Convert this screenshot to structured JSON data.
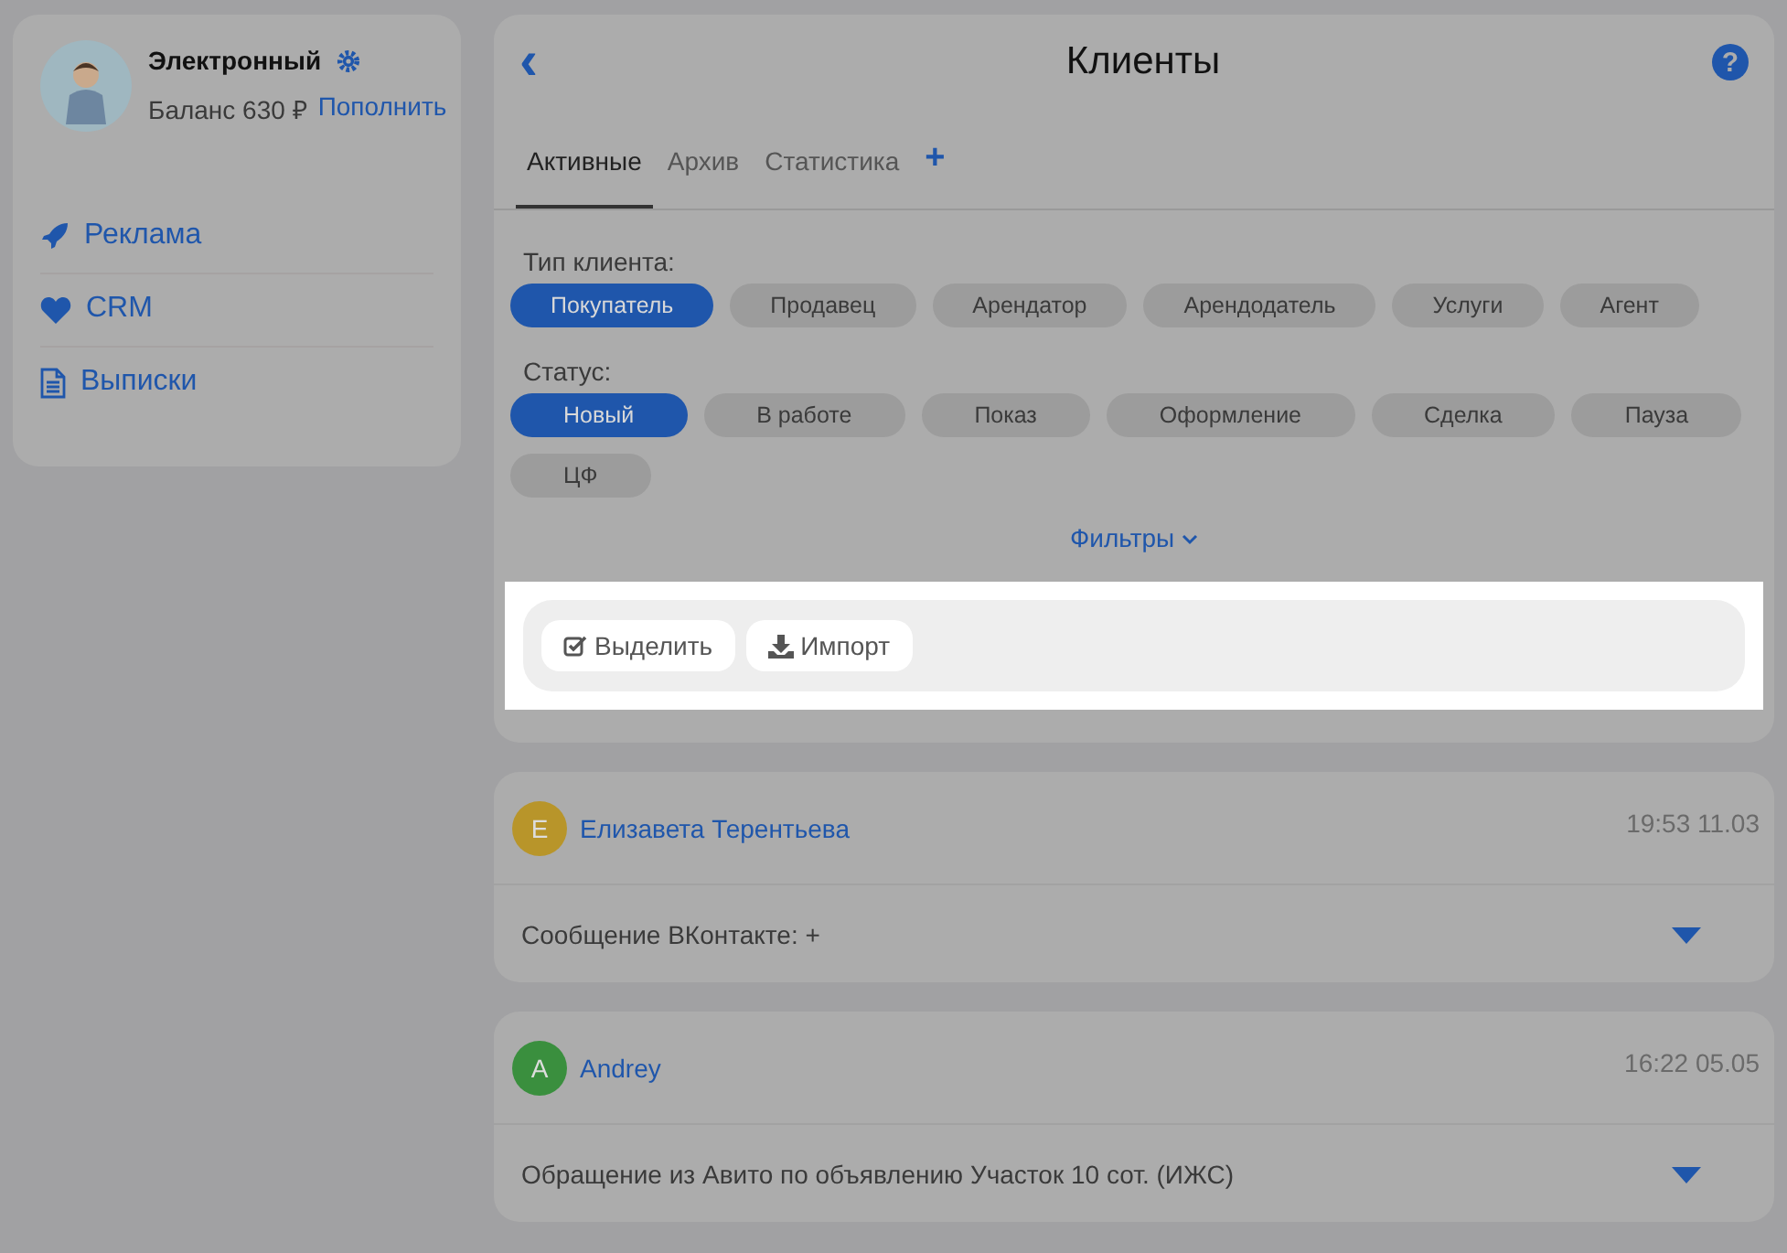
{
  "profile": {
    "name": "Электронный",
    "balance": "Баланс 630 ₽",
    "top_up": "Пополнить"
  },
  "menu": [
    {
      "label": "Реклама"
    },
    {
      "label": "CRM"
    },
    {
      "label": "Выписки"
    }
  ],
  "header": {
    "back": "‹",
    "title": "Клиенты",
    "help": "?"
  },
  "tabs": [
    {
      "label": "Активные",
      "selected": true
    },
    {
      "label": "Архив",
      "selected": false
    },
    {
      "label": "Статистика",
      "selected": false
    }
  ],
  "add_tab": "+",
  "client_type": {
    "label": "Тип клиента:",
    "options": [
      {
        "label": "Покупатель",
        "selected": true
      },
      {
        "label": "Продавец",
        "selected": false
      },
      {
        "label": "Арендатор",
        "selected": false
      },
      {
        "label": "Арендодатель",
        "selected": false
      },
      {
        "label": "Услуги",
        "selected": false
      },
      {
        "label": "Агент",
        "selected": false
      }
    ]
  },
  "status": {
    "label": "Статус:",
    "options": [
      {
        "label": "Новый",
        "selected": true
      },
      {
        "label": "В работе",
        "selected": false
      },
      {
        "label": "Показ",
        "selected": false
      },
      {
        "label": "Оформление",
        "selected": false
      },
      {
        "label": "Сделка",
        "selected": false
      },
      {
        "label": "Пауза",
        "selected": false
      },
      {
        "label": "ЦФ",
        "selected": false
      }
    ]
  },
  "filters_link": "Фильтры",
  "toolbar": [
    {
      "label": "Выделить"
    },
    {
      "label": "Импорт"
    }
  ],
  "clients": [
    {
      "initial": "Е",
      "name": "Елизавета Терентьева",
      "color": "#b8952a",
      "time": "19:53 11.03",
      "message": "Сообщение ВКонтакте: +"
    },
    {
      "initial": "A",
      "name": "Andrey",
      "color": "#3a8f3e",
      "time": "16:22 05.05",
      "message": "Обращение из Авито по объявлению Участок 10 сот. (ИЖС)"
    }
  ]
}
